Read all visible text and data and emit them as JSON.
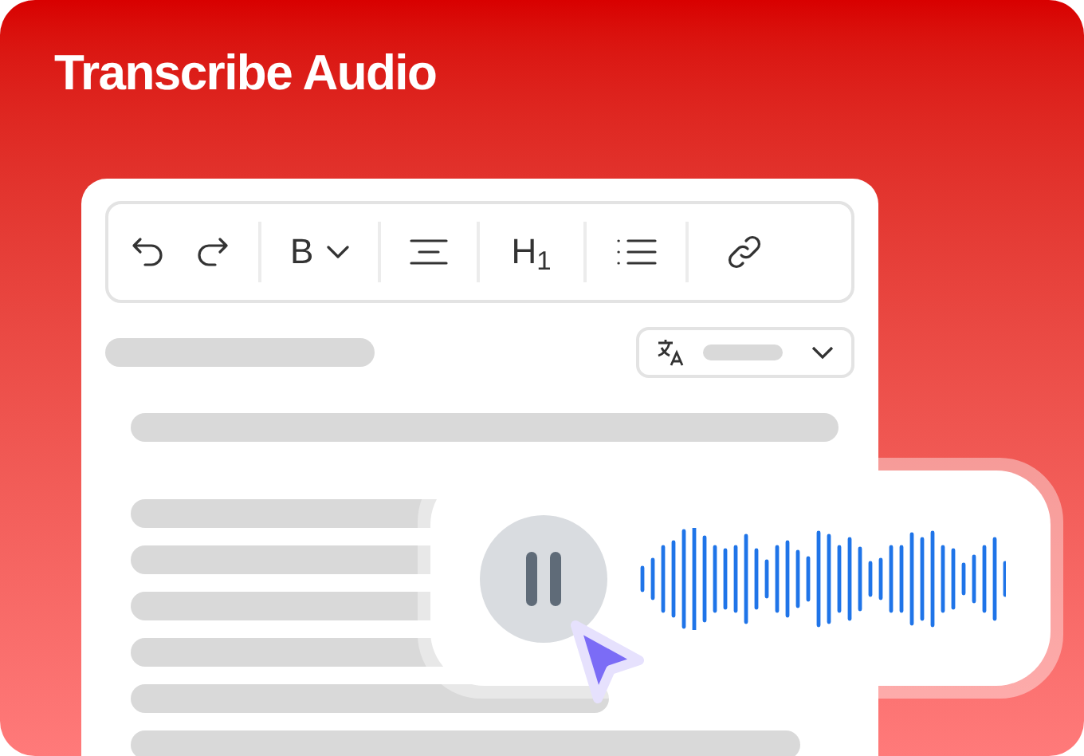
{
  "title": "Transcribe Audio",
  "toolbar": [
    {
      "kind": "undo"
    },
    {
      "kind": "redo"
    },
    {
      "kind": "divider"
    },
    {
      "kind": "bold",
      "label": "B"
    },
    {
      "kind": "divider"
    },
    {
      "kind": "align"
    },
    {
      "kind": "divider"
    },
    {
      "kind": "heading",
      "label": "H$_{1}$"
    },
    {
      "kind": "divider"
    },
    {
      "kind": "list"
    },
    {
      "kind": "divider"
    },
    {
      "kind": "link"
    }
  ]
}
